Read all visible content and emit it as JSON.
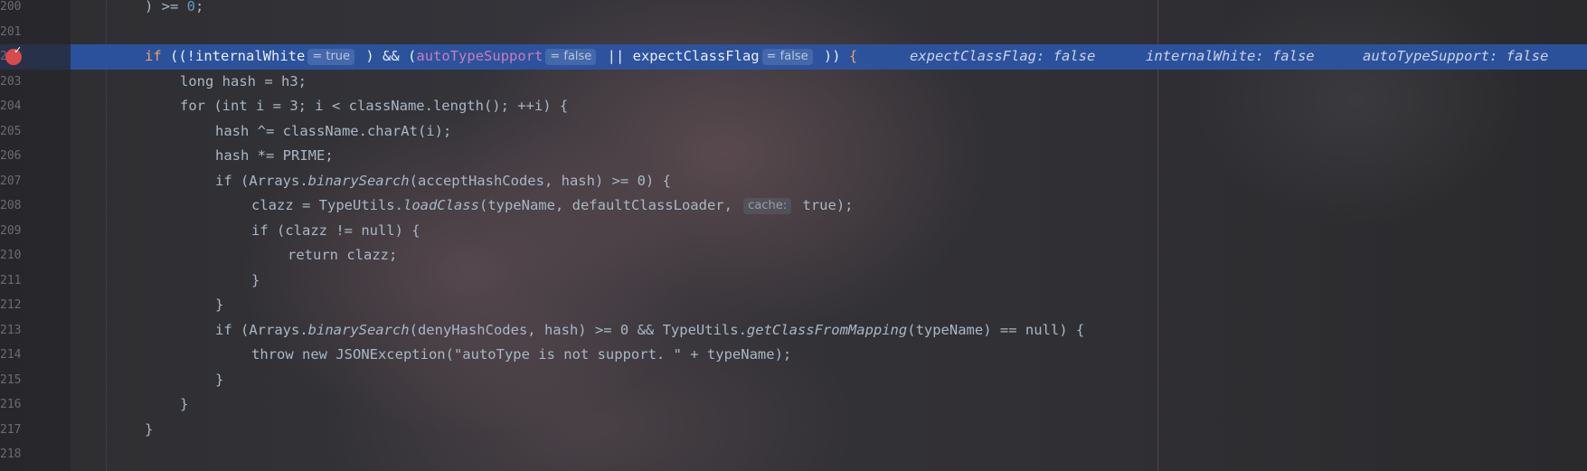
{
  "editor": {
    "lines": [
      {
        "num": "200",
        "parts": [
          {
            "t": ") >= ",
            "c": "txt"
          },
          {
            "t": "0",
            "c": "num"
          },
          {
            "t": ";",
            "c": "txt"
          }
        ]
      },
      {
        "num": "201",
        "parts": []
      },
      {
        "num": "202",
        "parts": []
      },
      {
        "num": "203",
        "parts": []
      },
      {
        "num": "204",
        "parts": []
      },
      {
        "num": "205",
        "parts": []
      },
      {
        "num": "206",
        "parts": []
      },
      {
        "num": "207",
        "parts": []
      },
      {
        "num": "208",
        "parts": []
      },
      {
        "num": "209",
        "parts": []
      },
      {
        "num": "210",
        "parts": []
      },
      {
        "num": "211",
        "parts": []
      },
      {
        "num": "212",
        "parts": []
      },
      {
        "num": "213",
        "parts": []
      },
      {
        "num": "214",
        "parts": []
      },
      {
        "num": "215",
        "parts": []
      },
      {
        "num": "216",
        "parts": []
      },
      {
        "num": "217",
        "parts": []
      },
      {
        "num": "218",
        "parts": []
      }
    ],
    "highlight_line": {
      "tokens": {
        "if": "if",
        "open": " ((!",
        "internalWhite": "internalWhite",
        "internalWhite_hint": "= true",
        "and": " ) && (",
        "autoTypeSupport": "autoTypeSupport",
        "autoTypeSupport_hint": "= false",
        "or": " || ",
        "expectClassFlag": "expectClassFlag",
        "expectClassFlag_hint": "= false",
        "close": " )) ",
        "brace": "{"
      },
      "inline_values": {
        "expectClassFlag": "expectClassFlag: false",
        "internalWhite": "internalWhite: false",
        "autoTypeSupport": "autoTypeSupport: false"
      }
    },
    "code": {
      "l203": "long hash = h3;",
      "l204": "for (int i = 3; i < className.length(); ++i) {",
      "l205": "hash ^= className.charAt(i);",
      "l206": "hash *= PRIME;",
      "l207_a": "if (Arrays.",
      "l207_m": "binarySearch",
      "l207_b": "(acceptHashCodes, hash) >= 0) {",
      "l208_a": "clazz = TypeUtils.",
      "l208_m": "loadClass",
      "l208_b": "(typeName, defaultClassLoader, ",
      "l208_hint": "cache:",
      "l208_c": " true);",
      "l209": "if (clazz != null) {",
      "l210": "return clazz;",
      "l211": "}",
      "l212": "}",
      "l213_a": "if (Arrays.",
      "l213_m": "binarySearch",
      "l213_b": "(denyHashCodes, hash) >= 0 && TypeUtils.",
      "l213_m2": "getClassFromMapping",
      "l213_c": "(typeName) == null) {",
      "l214": "throw new JSONException(\"autoType is not support. \" + typeName);",
      "l215": "}",
      "l216": "}",
      "l217": "}"
    }
  },
  "colors": {
    "highlight": "#2d55a5",
    "breakpoint": "#d94a4a"
  }
}
